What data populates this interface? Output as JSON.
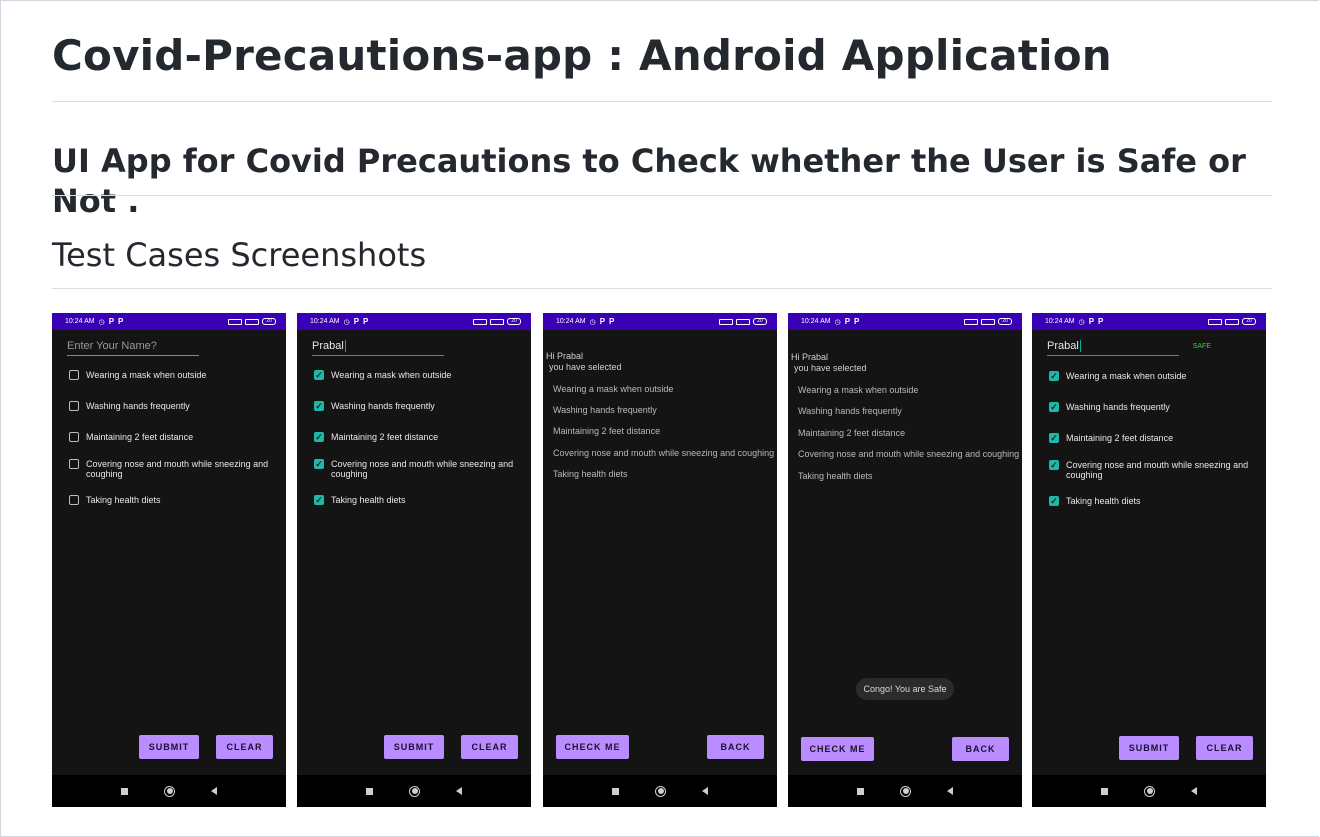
{
  "readme": {
    "title": "Covid-Precautions-app : Android Application",
    "subtitle": "UI App for Covid Precautions to Check whether the User is Safe or Not .",
    "section": "Test Cases Screenshots"
  },
  "status_time": "10:24 AM",
  "status_battery": "20",
  "status_p": "P",
  "name_placeholder": "Enter Your Name?",
  "user_name": "Prabal",
  "safe_label": "SAFE",
  "greeting": "Hi Prabal",
  "selected_label": "you have selected",
  "precautions": [
    "Wearing a mask when outside",
    "Washing hands frequently",
    "Maintaining 2 feet distance",
    "Covering nose and mouth while sneezing and coughing",
    "Taking health diets"
  ],
  "buttons": {
    "submit": "SUBMIT",
    "clear": "CLEAR",
    "check_me": "CHECK ME",
    "back": "BACK"
  },
  "toast": "Congo! You are Safe",
  "colors": {
    "status_bar": "#3a00b5",
    "button": "#b98cff",
    "checkbox_checked": "#1fb8a6",
    "safe": "#3ecf3e"
  }
}
